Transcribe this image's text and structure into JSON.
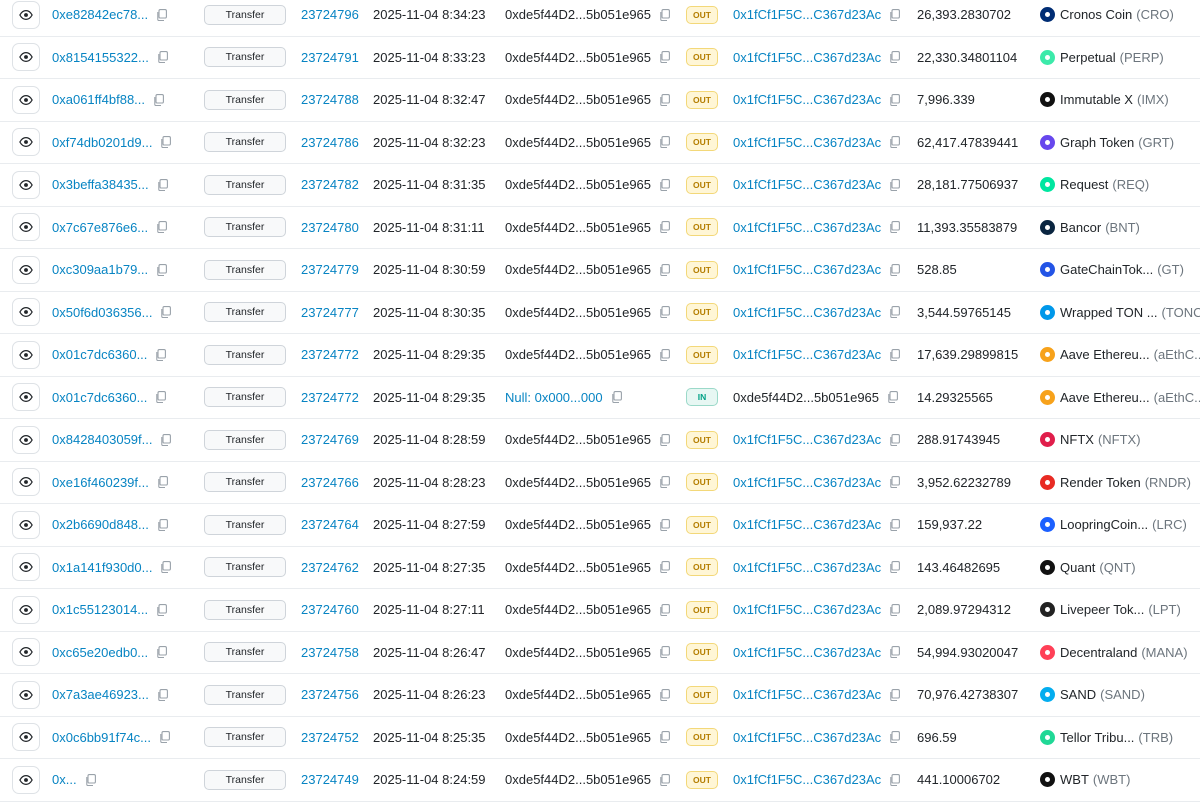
{
  "rows": [
    {
      "hash": "0xe82842ec78...",
      "method": "Transfer",
      "block": "23724796",
      "age": "2025-11-04 8:34:23",
      "from": "0xde5f44D2...5b051e965",
      "from_link": false,
      "dir": "OUT",
      "to": "0x1fCf1F5C...C367d23Ac",
      "to_link": true,
      "amount": "26,393.2830702",
      "token_name": "Cronos Coin",
      "token_symbol": "(CRO)",
      "token_color": "#002d74"
    },
    {
      "hash": "0x8154155322...",
      "method": "Transfer",
      "block": "23724791",
      "age": "2025-11-04 8:33:23",
      "from": "0xde5f44D2...5b051e965",
      "from_link": false,
      "dir": "OUT",
      "to": "0x1fCf1F5C...C367d23Ac",
      "to_link": true,
      "amount": "22,330.34801104",
      "token_name": "Perpetual",
      "token_symbol": "(PERP)",
      "token_color": "#3ceaaa"
    },
    {
      "hash": "0xa061ff4bf88...",
      "method": "Transfer",
      "block": "23724788",
      "age": "2025-11-04 8:32:47",
      "from": "0xde5f44D2...5b051e965",
      "from_link": false,
      "dir": "OUT",
      "to": "0x1fCf1F5C...C367d23Ac",
      "to_link": true,
      "amount": "7,996.339",
      "token_name": "Immutable X",
      "token_symbol": "(IMX)",
      "token_color": "#111111"
    },
    {
      "hash": "0xf74db0201d9...",
      "method": "Transfer",
      "block": "23724786",
      "age": "2025-11-04 8:32:23",
      "from": "0xde5f44D2...5b051e965",
      "from_link": false,
      "dir": "OUT",
      "to": "0x1fCf1F5C...C367d23Ac",
      "to_link": true,
      "amount": "62,417.47839441",
      "token_name": "Graph Token",
      "token_symbol": "(GRT)",
      "token_color": "#6747ed"
    },
    {
      "hash": "0x3beffa38435...",
      "method": "Transfer",
      "block": "23724782",
      "age": "2025-11-04 8:31:35",
      "from": "0xde5f44D2...5b051e965",
      "from_link": false,
      "dir": "OUT",
      "to": "0x1fCf1F5C...C367d23Ac",
      "to_link": true,
      "amount": "28,181.77506937",
      "token_name": "Request",
      "token_symbol": "(REQ)",
      "token_color": "#00e6a0"
    },
    {
      "hash": "0x7c67e876e6...",
      "method": "Transfer",
      "block": "23724780",
      "age": "2025-11-04 8:31:11",
      "from": "0xde5f44D2...5b051e965",
      "from_link": false,
      "dir": "OUT",
      "to": "0x1fCf1F5C...C367d23Ac",
      "to_link": true,
      "amount": "11,393.35583879",
      "token_name": "Bancor",
      "token_symbol": "(BNT)",
      "token_color": "#0a2540"
    },
    {
      "hash": "0xc309aa1b79...",
      "method": "Transfer",
      "block": "23724779",
      "age": "2025-11-04 8:30:59",
      "from": "0xde5f44D2...5b051e965",
      "from_link": false,
      "dir": "OUT",
      "to": "0x1fCf1F5C...C367d23Ac",
      "to_link": true,
      "amount": "528.85",
      "token_name": "GateChainTok...",
      "token_symbol": "(GT)",
      "token_color": "#2354e6"
    },
    {
      "hash": "0x50f6d036356...",
      "method": "Transfer",
      "block": "23724777",
      "age": "2025-11-04 8:30:35",
      "from": "0xde5f44D2...5b051e965",
      "from_link": false,
      "dir": "OUT",
      "to": "0x1fCf1F5C...C367d23Ac",
      "to_link": true,
      "amount": "3,544.59765145",
      "token_name": "Wrapped TON ...",
      "token_symbol": "(TONC",
      "token_color": "#0098ea"
    },
    {
      "hash": "0x01c7dc6360...",
      "method": "Transfer",
      "block": "23724772",
      "age": "2025-11-04 8:29:35",
      "from": "0xde5f44D2...5b051e965",
      "from_link": false,
      "dir": "OUT",
      "to": "0x1fCf1F5C...C367d23Ac",
      "to_link": true,
      "amount": "17,639.29899815",
      "token_name": "Aave Ethereu...",
      "token_symbol": "(aEthC...",
      "token_color": "#f7a21b"
    },
    {
      "hash": "0x01c7dc6360...",
      "method": "Transfer",
      "block": "23724772",
      "age": "2025-11-04 8:29:35",
      "from": "Null: 0x000...000",
      "from_link": true,
      "dir": "IN",
      "to": "0xde5f44D2...5b051e965",
      "to_link": false,
      "amount": "14.29325565",
      "token_name": "Aave Ethereu...",
      "token_symbol": "(aEthC...",
      "token_color": "#f7a21b"
    },
    {
      "hash": "0x8428403059f...",
      "method": "Transfer",
      "block": "23724769",
      "age": "2025-11-04 8:28:59",
      "from": "0xde5f44D2...5b051e965",
      "from_link": false,
      "dir": "OUT",
      "to": "0x1fCf1F5C...C367d23Ac",
      "to_link": true,
      "amount": "288.91743945",
      "token_name": "NFTX",
      "token_symbol": "(NFTX)",
      "token_color": "#e01e4b"
    },
    {
      "hash": "0xe16f460239f...",
      "method": "Transfer",
      "block": "23724766",
      "age": "2025-11-04 8:28:23",
      "from": "0xde5f44D2...5b051e965",
      "from_link": false,
      "dir": "OUT",
      "to": "0x1fCf1F5C...C367d23Ac",
      "to_link": true,
      "amount": "3,952.62232789",
      "token_name": "Render Token",
      "token_symbol": "(RNDR)",
      "token_color": "#e82b24"
    },
    {
      "hash": "0x2b6690d848...",
      "method": "Transfer",
      "block": "23724764",
      "age": "2025-11-04 8:27:59",
      "from": "0xde5f44D2...5b051e965",
      "from_link": false,
      "dir": "OUT",
      "to": "0x1fCf1F5C...C367d23Ac",
      "to_link": true,
      "amount": "159,937.22",
      "token_name": "LoopringCoin...",
      "token_symbol": "(LRC)",
      "token_color": "#1c60ff"
    },
    {
      "hash": "0x1a141f930d0...",
      "method": "Transfer",
      "block": "23724762",
      "age": "2025-11-04 8:27:35",
      "from": "0xde5f44D2...5b051e965",
      "from_link": false,
      "dir": "OUT",
      "to": "0x1fCf1F5C...C367d23Ac",
      "to_link": true,
      "amount": "143.46482695",
      "token_name": "Quant",
      "token_symbol": "(QNT)",
      "token_color": "#111111"
    },
    {
      "hash": "0x1c55123014...",
      "method": "Transfer",
      "block": "23724760",
      "age": "2025-11-04 8:27:11",
      "from": "0xde5f44D2...5b051e965",
      "from_link": false,
      "dir": "OUT",
      "to": "0x1fCf1F5C...C367d23Ac",
      "to_link": true,
      "amount": "2,089.97294312",
      "token_name": "Livepeer Tok...",
      "token_symbol": "(LPT)",
      "token_color": "#222222"
    },
    {
      "hash": "0xc65e20edb0...",
      "method": "Transfer",
      "block": "23724758",
      "age": "2025-11-04 8:26:47",
      "from": "0xde5f44D2...5b051e965",
      "from_link": false,
      "dir": "OUT",
      "to": "0x1fCf1F5C...C367d23Ac",
      "to_link": true,
      "amount": "54,994.93020047",
      "token_name": "Decentraland",
      "token_symbol": "(MANA)",
      "token_color": "#ff4057"
    },
    {
      "hash": "0x7a3ae46923...",
      "method": "Transfer",
      "block": "23724756",
      "age": "2025-11-04 8:26:23",
      "from": "0xde5f44D2...5b051e965",
      "from_link": false,
      "dir": "OUT",
      "to": "0x1fCf1F5C...C367d23Ac",
      "to_link": true,
      "amount": "70,976.42738307",
      "token_name": "SAND",
      "token_symbol": "(SAND)",
      "token_color": "#04adef"
    },
    {
      "hash": "0x0c6bb91f74c...",
      "method": "Transfer",
      "block": "23724752",
      "age": "2025-11-04 8:25:35",
      "from": "0xde5f44D2...5b051e965",
      "from_link": false,
      "dir": "OUT",
      "to": "0x1fCf1F5C...C367d23Ac",
      "to_link": true,
      "amount": "696.59",
      "token_name": "Tellor Tribu...",
      "token_symbol": "(TRB)",
      "token_color": "#20d896"
    },
    {
      "hash": "0x...",
      "method": "Transfer",
      "block": "23724749",
      "age": "2025-11-04 8:24:59",
      "from": "0xde5f44D2...5b051e965",
      "from_link": false,
      "dir": "OUT",
      "to": "0x1fCf1F5C...C367d23Ac",
      "to_link": true,
      "amount": "441.10006702",
      "token_name": "WBT",
      "token_symbol": "(WBT)",
      "token_color": "#111111"
    }
  ]
}
